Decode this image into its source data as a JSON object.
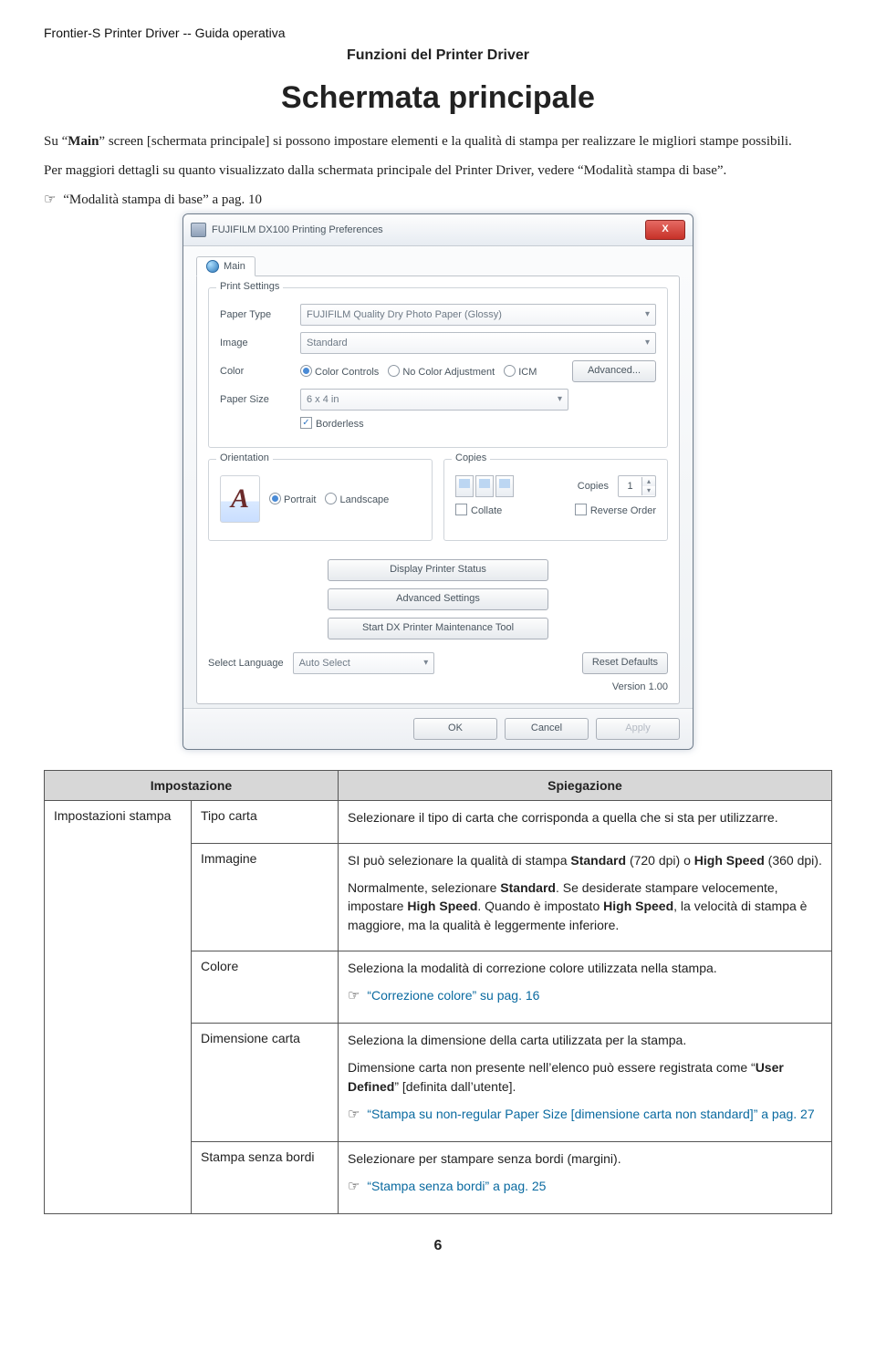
{
  "doc": {
    "running_head": "Frontier-S     Printer Driver -- Guida operativa",
    "section": "Funzioni del Printer Driver",
    "title": "Schermata principale",
    "para1_a": "Su “",
    "para1_b": "Main",
    "para1_c": "” screen [schermata principale] si possono impostare elementi e la qualità di stampa per realizzare le migliori stampe possibili.",
    "para2": "Per maggiori dettagli su quanto visualizzato dalla schermata principale del Printer Driver, vedere “Modalità stampa di base”.",
    "xref1": "“Modalità stampa di base” a pag. 10",
    "page_number": "6"
  },
  "dlg": {
    "title": "FUJIFILM DX100 Printing Preferences",
    "close": "X",
    "tab_main": "Main",
    "group_print_settings": "Print Settings",
    "lbl_paper_type": "Paper Type",
    "val_paper_type": "FUJIFILM Quality Dry Photo Paper (Glossy)",
    "lbl_image": "Image",
    "val_image": "Standard",
    "lbl_color": "Color",
    "opt_color_controls": "Color Controls",
    "opt_no_adjust": "No Color Adjustment",
    "opt_icm": "ICM",
    "btn_advanced": "Advanced...",
    "lbl_paper_size": "Paper Size",
    "val_paper_size": "6 x 4 in",
    "chk_borderless": "Borderless",
    "group_orientation": "Orientation",
    "opt_portrait": "Portrait",
    "opt_landscape": "Landscape",
    "group_copies": "Copies",
    "lbl_copies": "Copies",
    "val_copies": "1",
    "chk_collate": "Collate",
    "chk_reverse": "Reverse Order",
    "btn_status": "Display Printer Status",
    "btn_adv_settings": "Advanced Settings",
    "btn_maint": "Start DX Printer Maintenance Tool",
    "lbl_language": "Select Language",
    "val_language": "Auto Select",
    "btn_reset": "Reset Defaults",
    "version": "Version 1.00",
    "btn_ok": "OK",
    "btn_cancel": "Cancel",
    "btn_apply": "Apply"
  },
  "table": {
    "head_setting": "Impostazione",
    "head_desc": "Spiegazione",
    "cat": "Impostazioni stampa",
    "r1_name": "Tipo carta",
    "r1_desc": "Selezionare il tipo di carta che corrisponda a quella che si sta per utilizzarre.",
    "r2_name": "Immagine",
    "r2_p1_a": "SI può selezionare la qualità di stampa ",
    "r2_p1_b": "Standard",
    "r2_p1_c": " (720 dpi) o ",
    "r2_p1_d": "High Speed",
    "r2_p1_e": " (360 dpi).",
    "r2_p2_a": "Normalmente, selezionare ",
    "r2_p2_b": "Standard",
    "r2_p2_c": ". Se desiderate stampare velocemente, impostare ",
    "r2_p2_d": "High Speed",
    "r2_p2_e": ". Quando è impostato ",
    "r2_p2_f": "High Speed",
    "r2_p2_g": ", la velocità di stampa è maggiore, ma la qualità è leggermente inferiore.",
    "r3_name": "Colore",
    "r3_p1": "Seleziona la modalità di correzione colore utilizzata nella stampa.",
    "r3_link": "“Correzione colore” su pag. 16",
    "r4_name": "Dimensione carta",
    "r4_p1": "Seleziona la dimensione della carta utilizzata per la stampa.",
    "r4_p2_a": "Dimensione carta non presente nell’elenco può essere registrata come “",
    "r4_p2_b": "User Defined",
    "r4_p2_c": "” [definita dall’utente].",
    "r4_link": "“Stampa su non-regular Paper Size [dimensione carta non standard]” a pag. 27",
    "r5_name": "Stampa senza bordi",
    "r5_p1": "Selezionare per stampare senza bordi (margini).",
    "r5_link": "“Stampa senza bordi” a pag. 25"
  }
}
